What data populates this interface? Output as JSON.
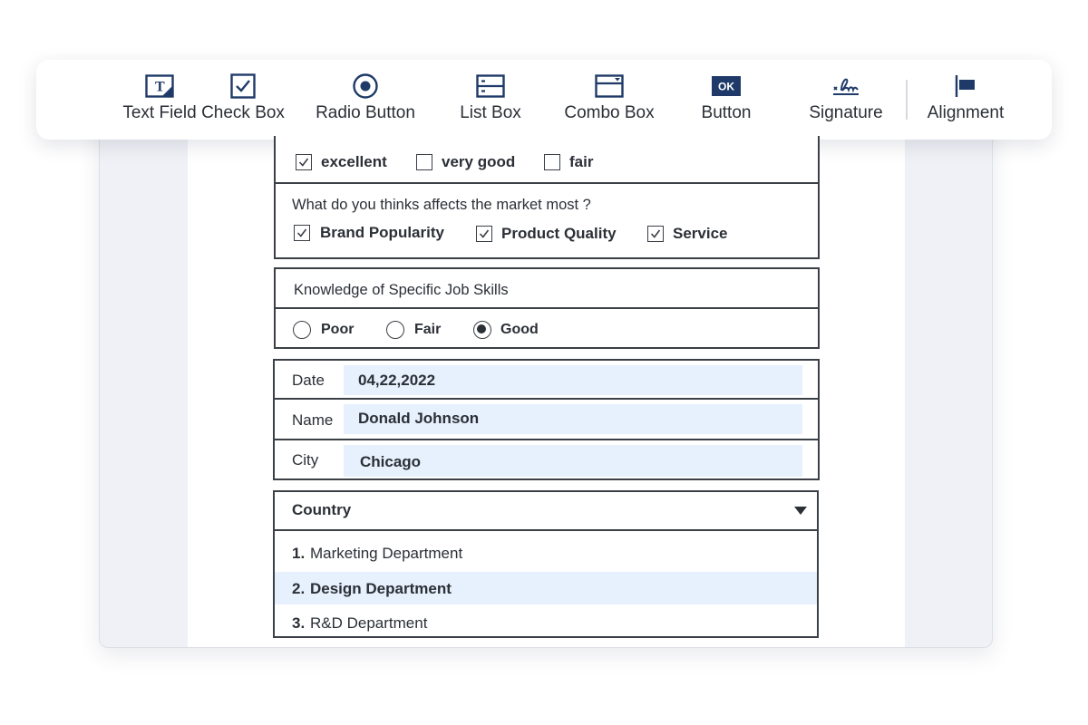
{
  "toolbar": {
    "items": [
      {
        "label": "Text Field",
        "icon": "text-field-icon"
      },
      {
        "label": "Check Box",
        "icon": "check-box-icon"
      },
      {
        "label": "Radio Button",
        "icon": "radio-button-icon"
      },
      {
        "label": "List Box",
        "icon": "list-box-icon"
      },
      {
        "label": "Combo Box",
        "icon": "combo-box-icon"
      },
      {
        "label": "Button",
        "icon": "button-ok-icon"
      },
      {
        "label": "Signature",
        "icon": "signature-icon"
      },
      {
        "label": "Alignment",
        "icon": "alignment-icon"
      }
    ],
    "button_icon_text": "OK",
    "text_icon_letter": "T",
    "icon_color": "#1f3a68"
  },
  "rating": {
    "options": [
      {
        "label": "excellent",
        "checked": true
      },
      {
        "label": "very good",
        "checked": false
      },
      {
        "label": "fair",
        "checked": false
      }
    ]
  },
  "market": {
    "question": "What do you thinks affects the market most ?",
    "options": [
      {
        "label": "Brand Popularity",
        "checked": true
      },
      {
        "label": "Product Quality",
        "checked": true
      },
      {
        "label": "Service",
        "checked": true
      }
    ]
  },
  "skills": {
    "title": "Knowledge of Specific Job Skills",
    "options": [
      {
        "label": "Poor",
        "selected": false
      },
      {
        "label": "Fair",
        "selected": false
      },
      {
        "label": "Good",
        "selected": true
      }
    ]
  },
  "info": {
    "date_label": "Date",
    "date_value": "04,22,2022",
    "name_label": "Name",
    "name_value": "Donald Johnson",
    "city_label": "City",
    "city_value": "Chicago"
  },
  "country": {
    "label": "Country",
    "items": [
      {
        "num": "1.",
        "text": "Marketing Department",
        "selected": false
      },
      {
        "num": "2.",
        "text": "Design Department",
        "selected": true
      },
      {
        "num": "3.",
        "text": "R&D Department",
        "selected": false
      }
    ]
  },
  "colors": {
    "field_fill": "#e6f1fd",
    "border": "#3b3f46",
    "frame": "#eff1f6"
  }
}
